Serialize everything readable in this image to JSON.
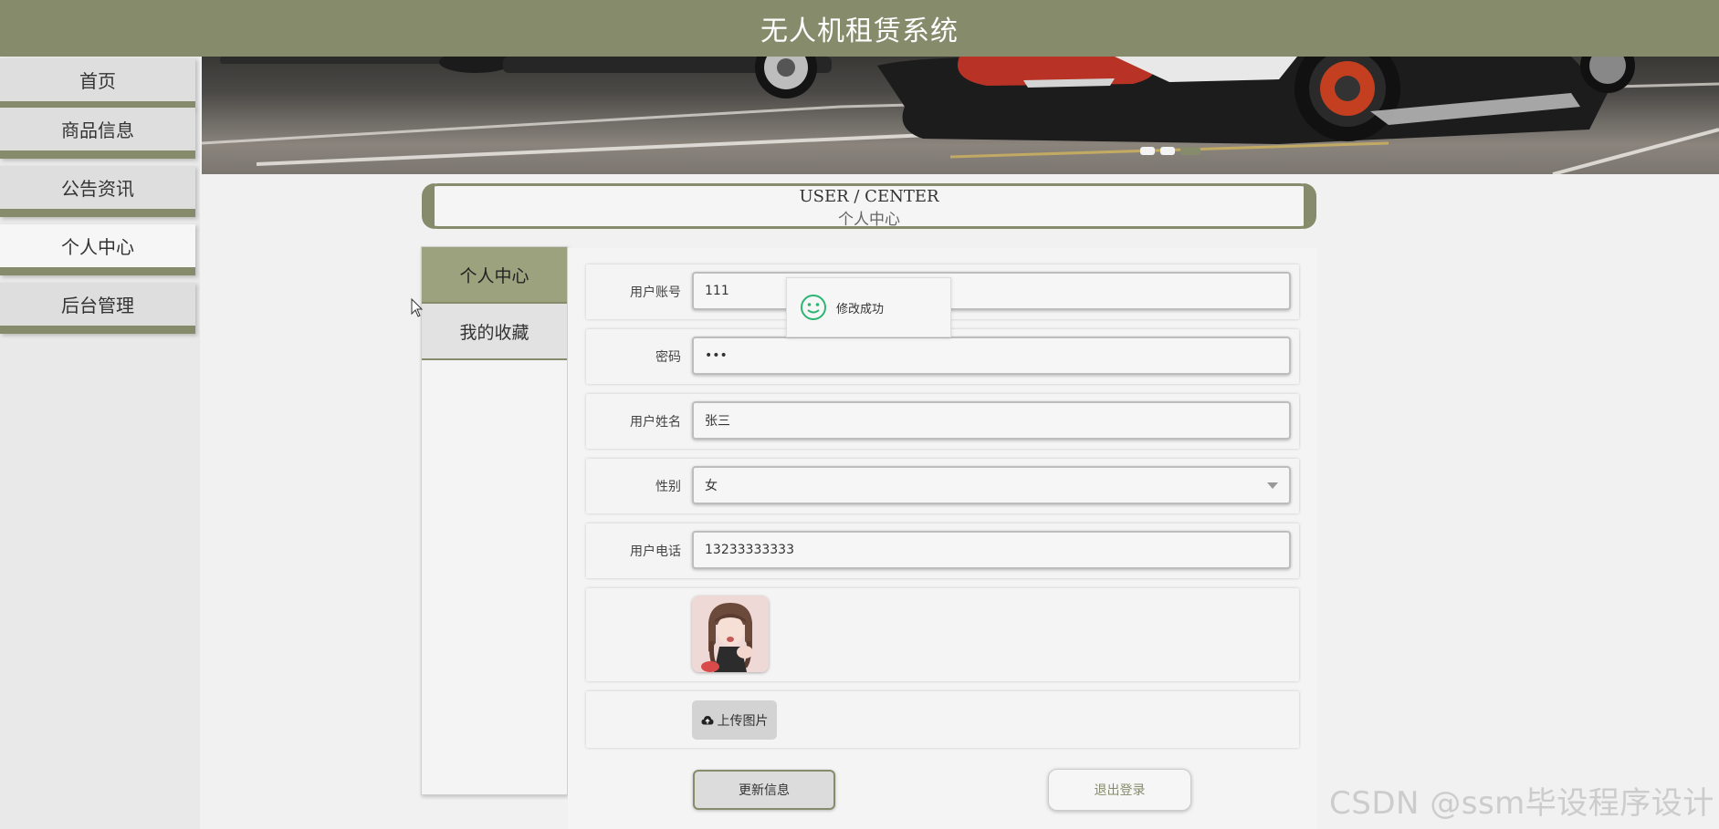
{
  "header": {
    "title": "无人机租赁系统"
  },
  "sidebar": {
    "items": [
      {
        "label": "首页"
      },
      {
        "label": "商品信息"
      },
      {
        "label": "公告资讯"
      },
      {
        "label": "个人中心",
        "active": true
      },
      {
        "label": "后台管理"
      }
    ]
  },
  "banner": {
    "slides": 3,
    "active_slide": 3
  },
  "section": {
    "title_en": "USER / CENTER",
    "title_cn": "个人中心"
  },
  "tabs": [
    {
      "label": "个人中心",
      "active": true
    },
    {
      "label": "我的收藏"
    }
  ],
  "form": {
    "account": {
      "label": "用户账号",
      "value": "111"
    },
    "password": {
      "label": "密码",
      "value": "•••"
    },
    "name": {
      "label": "用户姓名",
      "value": "张三"
    },
    "gender": {
      "label": "性别",
      "value": "女"
    },
    "phone": {
      "label": "用户电话",
      "value": "13233333333"
    },
    "upload_label": "上传图片"
  },
  "buttons": {
    "update": "更新信息",
    "logout": "退出登录"
  },
  "toast": {
    "message": "修改成功"
  },
  "watermark": "CSDN @ssm毕设程序设计",
  "colors": {
    "accent": "#868c6b",
    "background": "#f1f1f1",
    "toast_icon": "#2bb673"
  }
}
